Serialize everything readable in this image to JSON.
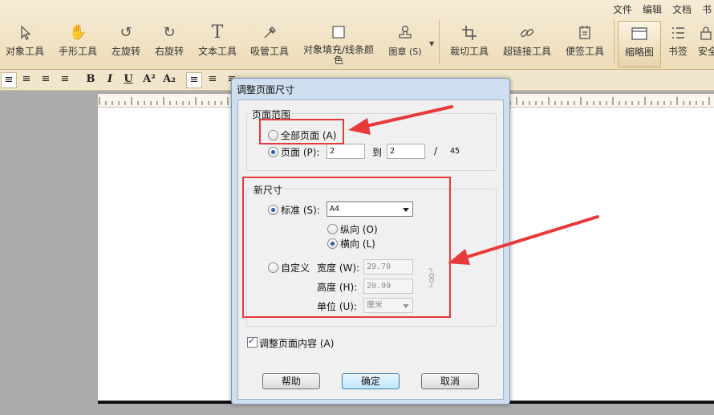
{
  "menu": {
    "file": "文件",
    "edit": "编辑",
    "doc": "文档",
    "more": "书"
  },
  "toolbar": {
    "object_tool": "对象工具",
    "hand_tool": "手形工具",
    "rotate_left": "左旋转",
    "rotate_right": "右旋转",
    "text_tool": "文本工具",
    "eyedropper_tool": "吸管工具",
    "object_fill": "对象填充/线条颜色",
    "stamp": "图章 (S)",
    "crop_tool": "裁切工具",
    "hyperlink_tool": "超链接工具",
    "sticky_tool": "便签工具",
    "thumbnails": "缩略图",
    "bookmarks": "书签",
    "security": "安全"
  },
  "format_bar": {
    "bold": "B",
    "italic": "I",
    "underline": "U",
    "superscript": "A²",
    "subscript": "A₂"
  },
  "dialog": {
    "title": "调整页面尺寸",
    "page_range": {
      "title": "页面范围",
      "all_pages": "全部页面 (A)",
      "pages": "页面 (P):",
      "from": "2",
      "to_label": "到",
      "to": "2",
      "slash": "/",
      "total": "45"
    },
    "new_size": {
      "title": "新尺寸",
      "standard": "标准 (S):",
      "standard_value": "A4",
      "portrait": "纵向 (O)",
      "landscape": "横向 (L)",
      "custom": "自定义",
      "width_label": "宽度 (W):",
      "width": "29.70",
      "height_label": "高度 (H):",
      "height": "20.99",
      "unit_label": "单位 (U):",
      "unit": "厘米"
    },
    "adjust_content": "调整页面内容 (A)",
    "help": "帮助",
    "ok": "确定",
    "cancel": "取消"
  },
  "colors": {
    "annotation_red": "#e8393b"
  }
}
